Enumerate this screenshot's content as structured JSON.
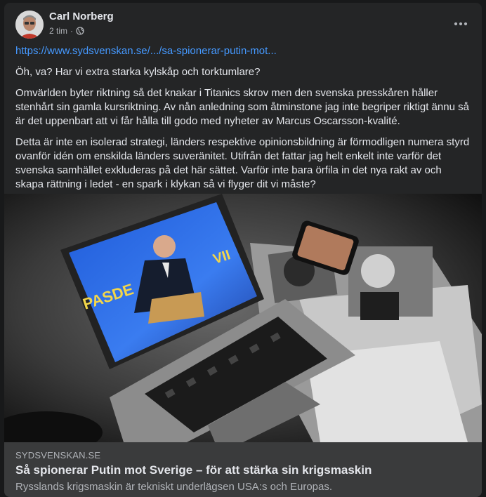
{
  "post": {
    "author": "Carl Norberg",
    "time": "2 tim",
    "separator": "·",
    "link_text": "https://www.sydsvenskan.se/.../sa-spionerar-putin-mot...",
    "paragraphs": [
      "Öh, va? Har vi extra starka kylskåp och torktumlare?",
      "Omvärlden byter riktning så det knakar i Titanics skrov men den svenska presskåren håller stenhårt sin gamla kursriktning. Av nån anledning som åtminstone jag inte begriper riktigt ännu så är det uppenbart att vi får hålla till godo med nyheter av Marcus Oscarsson-kvalité.",
      "Detta är inte en isolerad strategi, länders respektive opinionsbildning är förmodligen numera styrd ovanför idén om enskilda länders suveränitet. Utifrån det fattar jag helt enkelt inte varför det svenska samhället exkluderas på det här sättet. Varför inte bara örfila in det nya rakt av och skapa rättning i ledet - en spark i klykan så vi flyger dit vi måste?"
    ]
  },
  "link_preview": {
    "domain": "SYDSVENSKAN.SE",
    "title": "Så spionerar Putin mot Sverige – för att stärka sin krigsmaskin",
    "description": "Rysslands krigsmaskin är tekniskt underlägsen USA:s och Europas."
  },
  "image": {
    "screen_text_1": "PASDE",
    "screen_text_2": "VII"
  },
  "icons": {
    "globe": "globe-icon",
    "more": "more-options-icon"
  },
  "colors": {
    "background": "#18191a",
    "card": "#242526",
    "preview_bg": "#3a3b3c",
    "link": "#4599ff",
    "secondary_text": "#b0b3b8"
  }
}
